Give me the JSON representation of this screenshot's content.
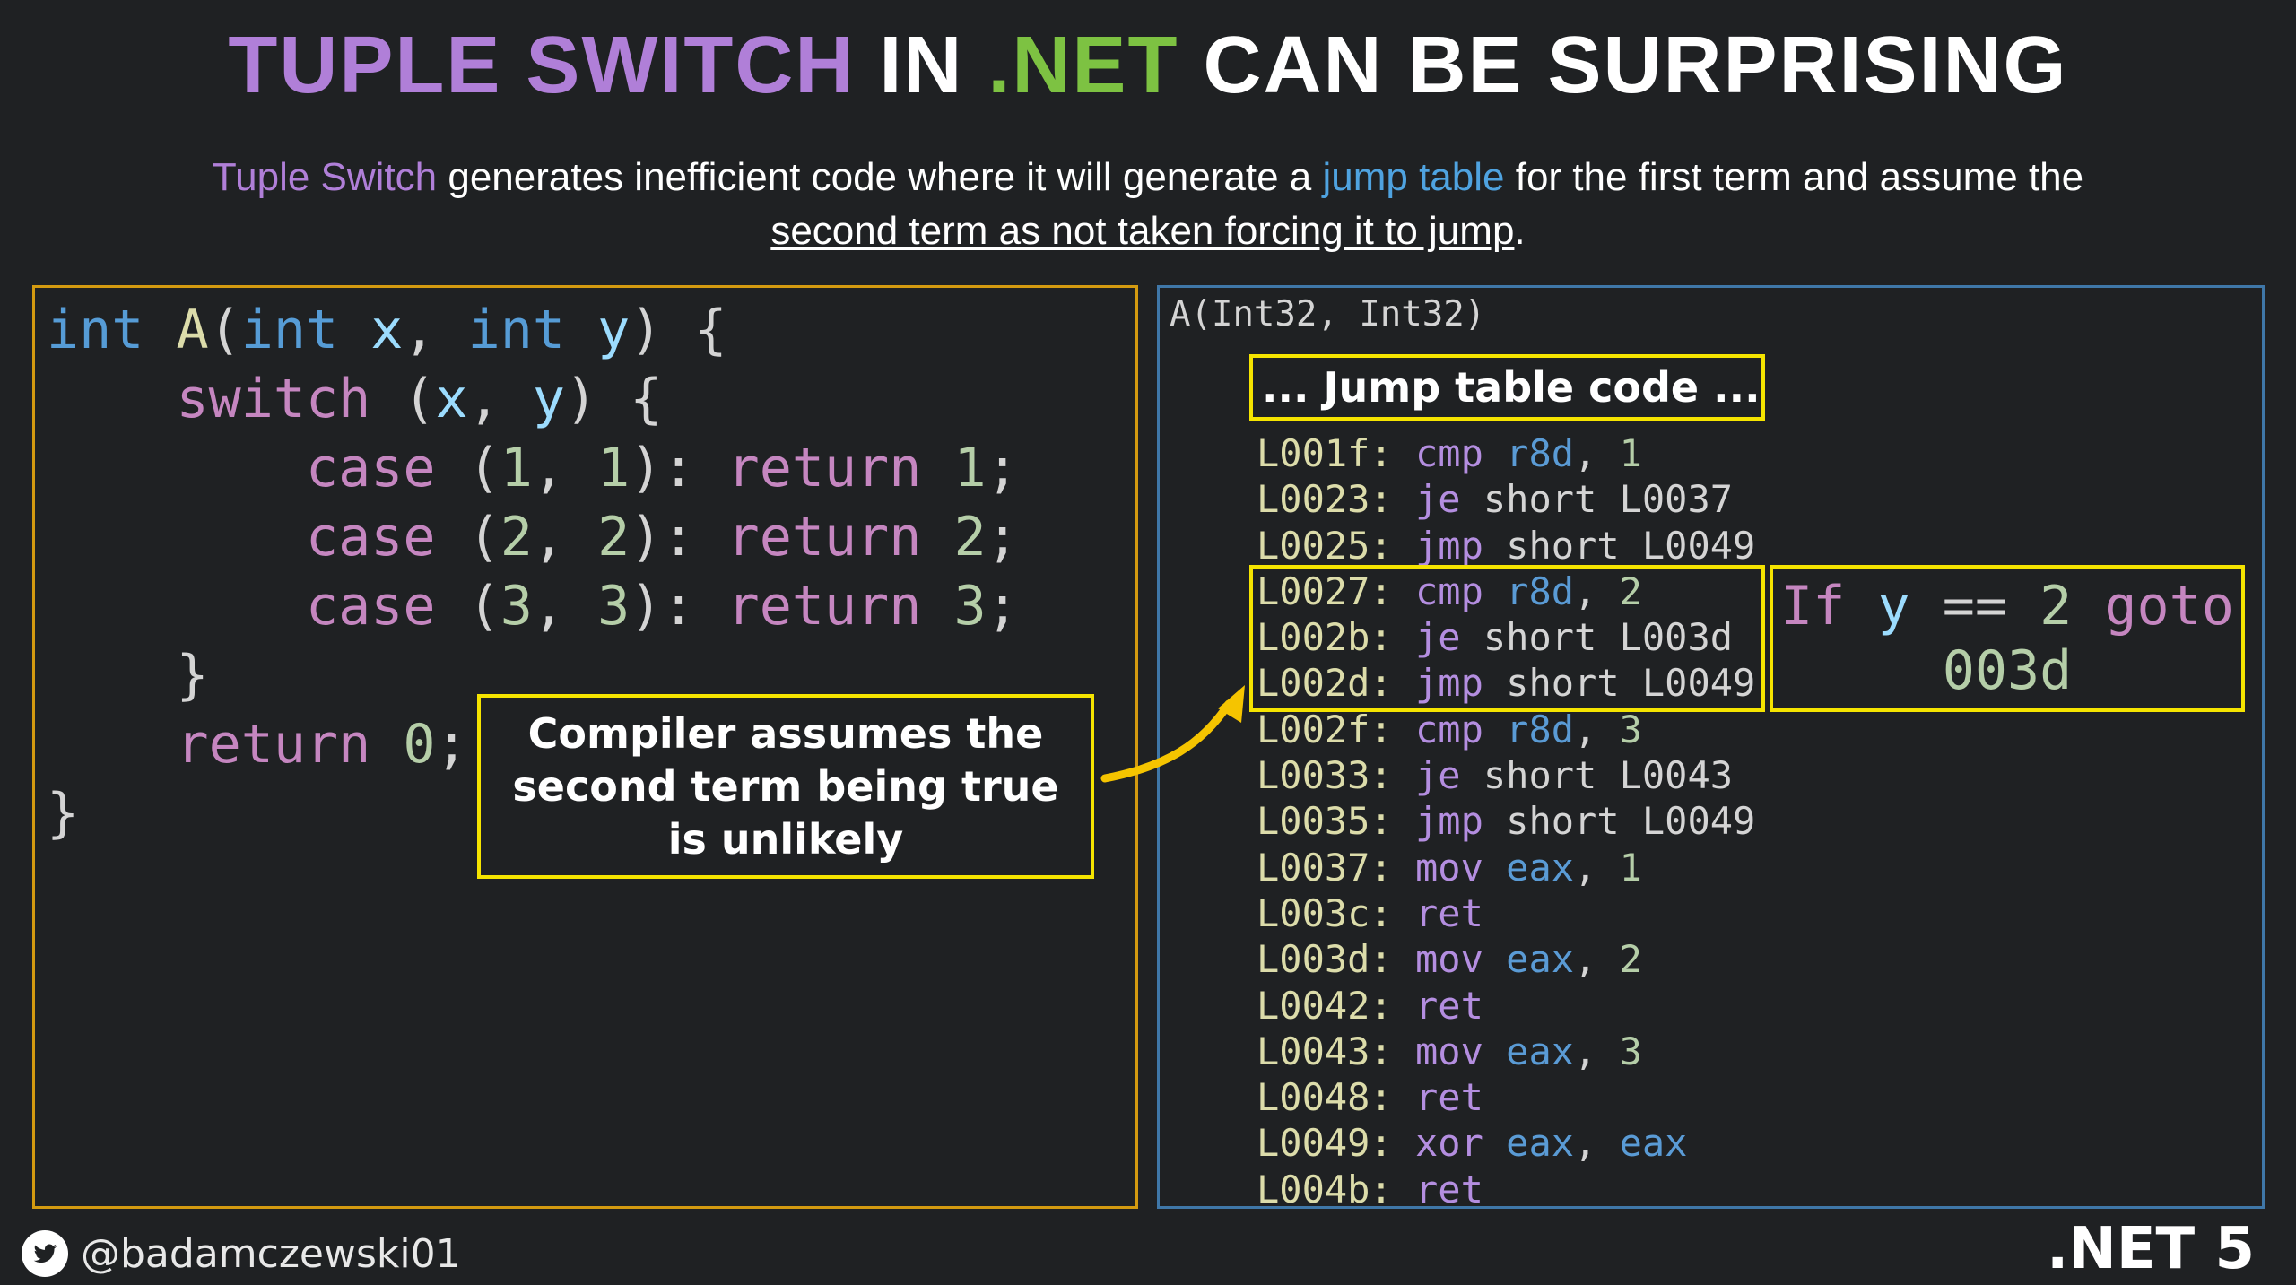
{
  "title": {
    "part1": "TUPLE SWITCH",
    "part2": "IN",
    "part3": ".NET",
    "part4": "CAN BE SURPRISING"
  },
  "subtitle": {
    "s1": "Tuple Switch",
    "s2": " generates inefficient code where it will generate a ",
    "s3": "jump table",
    "s4": " for the first term and assume the",
    "s5": "second term as not taken forcing it to jump",
    "s6": "."
  },
  "source_code": [
    [
      [
        "kb",
        "int"
      ],
      [
        "kw",
        " "
      ],
      [
        "ky",
        "A"
      ],
      [
        "kw",
        "("
      ],
      [
        "kb",
        "int"
      ],
      [
        "kw",
        " "
      ],
      [
        "kl",
        "x"
      ],
      [
        "kw",
        ", "
      ],
      [
        "kb",
        "int"
      ],
      [
        "kw",
        " "
      ],
      [
        "kl",
        "y"
      ],
      [
        "kw",
        ") {"
      ]
    ],
    [
      [
        "kw",
        "    "
      ],
      [
        "kp",
        "switch"
      ],
      [
        "kw",
        " ("
      ],
      [
        "kl",
        "x"
      ],
      [
        "kw",
        ", "
      ],
      [
        "kl",
        "y"
      ],
      [
        "kw",
        ") {"
      ]
    ],
    [
      [
        "kw",
        "        "
      ],
      [
        "kp",
        "case"
      ],
      [
        "kw",
        " ("
      ],
      [
        "kg",
        "1"
      ],
      [
        "kw",
        ", "
      ],
      [
        "kg",
        "1"
      ],
      [
        "kw",
        "): "
      ],
      [
        "kp",
        "return"
      ],
      [
        "kw",
        " "
      ],
      [
        "kg",
        "1"
      ],
      [
        "kw",
        ";"
      ]
    ],
    [
      [
        "kw",
        "        "
      ],
      [
        "kp",
        "case"
      ],
      [
        "kw",
        " ("
      ],
      [
        "kg",
        "2"
      ],
      [
        "kw",
        ", "
      ],
      [
        "kg",
        "2"
      ],
      [
        "kw",
        "): "
      ],
      [
        "kp",
        "return"
      ],
      [
        "kw",
        " "
      ],
      [
        "kg",
        "2"
      ],
      [
        "kw",
        ";"
      ]
    ],
    [
      [
        "kw",
        "        "
      ],
      [
        "kp",
        "case"
      ],
      [
        "kw",
        " ("
      ],
      [
        "kg",
        "3"
      ],
      [
        "kw",
        ", "
      ],
      [
        "kg",
        "3"
      ],
      [
        "kw",
        "): "
      ],
      [
        "kp",
        "return"
      ],
      [
        "kw",
        " "
      ],
      [
        "kg",
        "3"
      ],
      [
        "kw",
        ";"
      ]
    ],
    [
      [
        "kw",
        "    }"
      ]
    ],
    [
      [
        "kw",
        "    "
      ],
      [
        "kp",
        "return"
      ],
      [
        "kw",
        " "
      ],
      [
        "kg",
        "0"
      ],
      [
        "kw",
        ";"
      ]
    ],
    [
      [
        "kw",
        "}"
      ]
    ]
  ],
  "callout": "Compiler assumes the second term being true is unlikely",
  "asm": {
    "signature": "A(Int32, Int32)",
    "jump_table_label": "... Jump table code ...",
    "lines": [
      {
        "label": "L001f:",
        "op": "cmp",
        "args": [
          [
            "kr",
            "r8d"
          ],
          [
            "kw",
            ", "
          ],
          [
            "kg",
            "1"
          ]
        ]
      },
      {
        "label": "L0023:",
        "op": "je",
        "args": [
          [
            "kw",
            "short L0037"
          ]
        ]
      },
      {
        "label": "L0025:",
        "op": "jmp",
        "args": [
          [
            "kw",
            "short L0049"
          ]
        ]
      },
      {
        "label": "L0027:",
        "op": "cmp",
        "args": [
          [
            "kr",
            "r8d"
          ],
          [
            "kw",
            ", "
          ],
          [
            "kg",
            "2"
          ]
        ]
      },
      {
        "label": "L002b:",
        "op": "je",
        "args": [
          [
            "kw",
            "short L003d"
          ]
        ]
      },
      {
        "label": "L002d:",
        "op": "jmp",
        "args": [
          [
            "kw",
            "short L0049"
          ]
        ]
      },
      {
        "label": "L002f:",
        "op": "cmp",
        "args": [
          [
            "kr",
            "r8d"
          ],
          [
            "kw",
            ", "
          ],
          [
            "kg",
            "3"
          ]
        ]
      },
      {
        "label": "L0033:",
        "op": "je",
        "args": [
          [
            "kw",
            "short L0043"
          ]
        ]
      },
      {
        "label": "L0035:",
        "op": "jmp",
        "args": [
          [
            "kw",
            "short L0049"
          ]
        ]
      },
      {
        "label": "L0037:",
        "op": "mov",
        "args": [
          [
            "kr",
            "eax"
          ],
          [
            "kw",
            ", "
          ],
          [
            "kg",
            "1"
          ]
        ]
      },
      {
        "label": "L003c:",
        "op": "ret",
        "args": []
      },
      {
        "label": "L003d:",
        "op": "mov",
        "args": [
          [
            "kr",
            "eax"
          ],
          [
            "kw",
            ", "
          ],
          [
            "kg",
            "2"
          ]
        ]
      },
      {
        "label": "L0042:",
        "op": "ret",
        "args": []
      },
      {
        "label": "L0043:",
        "op": "mov",
        "args": [
          [
            "kr",
            "eax"
          ],
          [
            "kw",
            ", "
          ],
          [
            "kg",
            "3"
          ]
        ]
      },
      {
        "label": "L0048:",
        "op": "ret",
        "args": []
      },
      {
        "label": "L0049:",
        "op": "xor",
        "args": [
          [
            "kr",
            "eax"
          ],
          [
            "kw",
            ", "
          ],
          [
            "kr",
            "eax"
          ]
        ]
      },
      {
        "label": "L004b:",
        "op": "ret",
        "args": []
      }
    ]
  },
  "if_note": {
    "w1": "If",
    "w2": "y",
    "w3": "==",
    "w4": "2",
    "w5": "goto",
    "w6": "003d"
  },
  "footer": {
    "handle": "@badamczewski01",
    "icon": "twitter-icon",
    "version": ".NET 5"
  },
  "colors": {
    "accent_purple": "#b07fd8",
    "accent_green": "#7dc242",
    "highlight_yellow": "#f5e400",
    "left_border": "#d39a10",
    "right_border": "#3f77a8"
  }
}
